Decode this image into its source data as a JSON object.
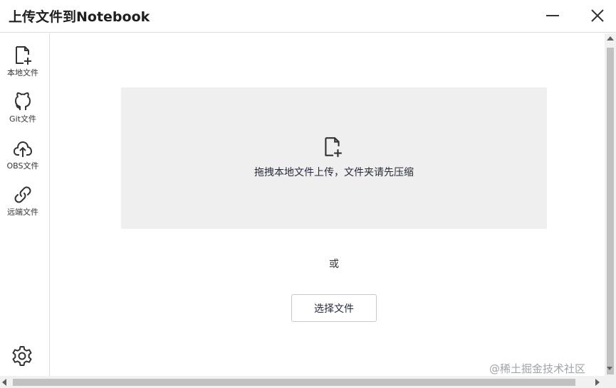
{
  "window": {
    "title": "上传文件到Notebook",
    "minimize_icon": "minimize-icon",
    "close_icon": "close-icon"
  },
  "sidebar": {
    "items": [
      {
        "label": "本地文件",
        "icon": "file-add-icon"
      },
      {
        "label": "Git文件",
        "icon": "github-icon"
      },
      {
        "label": "OBS文件",
        "icon": "cloud-upload-icon"
      },
      {
        "label": "远端文件",
        "icon": "link-icon"
      }
    ],
    "settings_icon": "gear-icon"
  },
  "main": {
    "dropzone_text": "拖拽本地文件上传，文件夹请先压缩",
    "dropzone_icon": "file-add-icon",
    "or_text": "或",
    "choose_button": "选择文件"
  },
  "watermark": "@稀土掘金技术社区",
  "colors": {
    "dropzone_bg": "#efefef",
    "border": "#dcdcdc",
    "text": "#252b3a",
    "scrollbar_thumb": "#c1c1c1"
  }
}
